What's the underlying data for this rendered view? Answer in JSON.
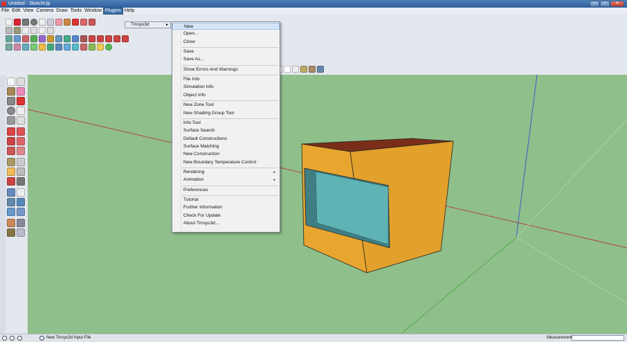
{
  "window": {
    "title": "Untitled - SketchUp"
  },
  "menubar": [
    "File",
    "Edit",
    "View",
    "Camera",
    "Draw",
    "Tools",
    "Window",
    "Plugins",
    "Help"
  ],
  "plugins_menu": {
    "item": "Trnsys3d"
  },
  "submenu": {
    "groups": [
      [
        {
          "label": "New"
        },
        {
          "label": "Open..."
        },
        {
          "label": "Close"
        }
      ],
      [
        {
          "label": "Save"
        },
        {
          "label": "Save As..."
        }
      ],
      [
        {
          "label": "Show Errors And Warnings"
        }
      ],
      [
        {
          "label": "File Info"
        },
        {
          "label": "Simulation Info"
        },
        {
          "label": "Object Info"
        }
      ],
      [
        {
          "label": "New Zone Tool"
        },
        {
          "label": "New Shading Group Tool"
        }
      ],
      [
        {
          "label": "Info Tool"
        },
        {
          "label": "Surface Search"
        },
        {
          "label": "Default Constructions"
        },
        {
          "label": "Surface Matching"
        },
        {
          "label": "New Construction"
        },
        {
          "label": "New Boundary Temperature Control"
        }
      ],
      [
        {
          "label": "Rendering",
          "submenu": true
        },
        {
          "label": "Animation",
          "submenu": true
        }
      ],
      [
        {
          "label": "Preferences"
        }
      ],
      [
        {
          "label": "Tutorial"
        },
        {
          "label": "Further Information"
        },
        {
          "label": "Check For Update"
        },
        {
          "label": "About Trnsys3d..."
        }
      ]
    ]
  },
  "statusbar": {
    "message": "New Trnsys3d Input File",
    "measurements_label": "Measurements",
    "measurements_value": ""
  },
  "colors": {
    "ground": "#8fbf8b",
    "wall": "#e8a630",
    "roof": "#7a2e18",
    "glass": "#5fb3b5"
  }
}
